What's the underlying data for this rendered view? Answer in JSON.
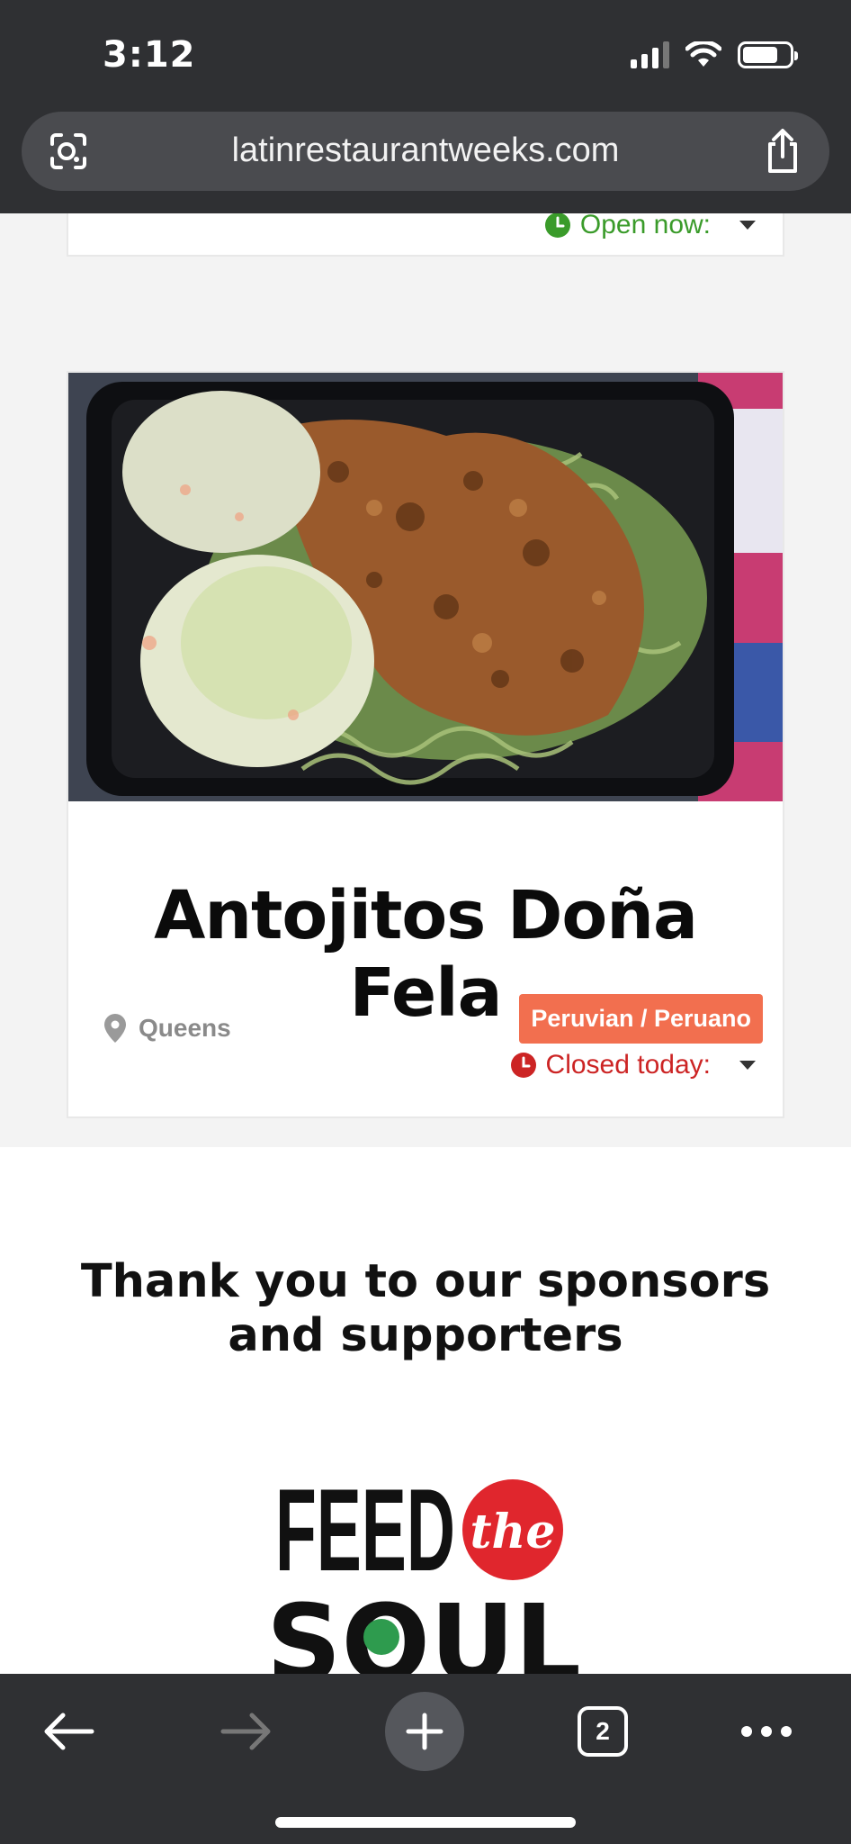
{
  "status_bar": {
    "time": "3:12"
  },
  "browser": {
    "url": "latinrestaurantweeks.com",
    "tab_count": "2"
  },
  "previous_card": {
    "hours_label": "Open now:"
  },
  "restaurant_card": {
    "name": "Antojitos Doña Fela",
    "location": "Queens",
    "cuisine": "Peruvian / Peruano",
    "hours_label": "Closed today:"
  },
  "sponsors": {
    "title": "Thank you to our sponsors and supporters",
    "logo_text": {
      "line1": "FEED",
      "mid": "the",
      "line2": "SOUL"
    }
  },
  "colors": {
    "chrome": "#2f3033",
    "open": "#3a9b2a",
    "closed": "#cc2424",
    "badge": "#f26f4f"
  }
}
